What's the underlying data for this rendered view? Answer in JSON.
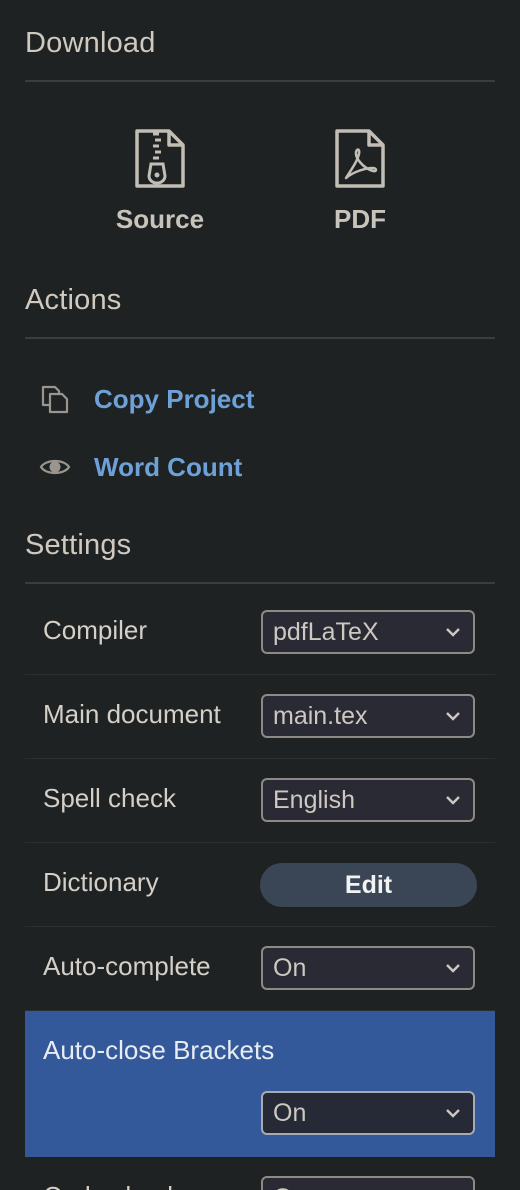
{
  "download": {
    "title": "Download",
    "items": [
      {
        "label": "Source",
        "icon": "zip-file-icon"
      },
      {
        "label": "PDF",
        "icon": "pdf-file-icon"
      }
    ]
  },
  "actions": {
    "title": "Actions",
    "items": [
      {
        "label": "Copy Project",
        "icon": "copy-icon"
      },
      {
        "label": "Word Count",
        "icon": "eye-icon"
      }
    ]
  },
  "settings": {
    "title": "Settings",
    "compiler": {
      "label": "Compiler",
      "value": "pdfLaTeX"
    },
    "main_document": {
      "label": "Main document",
      "value": "main.tex"
    },
    "spell_check": {
      "label": "Spell check",
      "value": "English"
    },
    "dictionary": {
      "label": "Dictionary",
      "button": "Edit"
    },
    "auto_complete": {
      "label": "Auto-complete",
      "value": "On"
    },
    "auto_close_brackets": {
      "label": "Auto-close Brackets",
      "value": "On"
    },
    "code_check": {
      "label": "Code check",
      "value": "On"
    }
  },
  "colors": {
    "background": "#1f2223",
    "link": "#6ea1d8",
    "highlight": "#33599a",
    "button": "#3a4656"
  }
}
